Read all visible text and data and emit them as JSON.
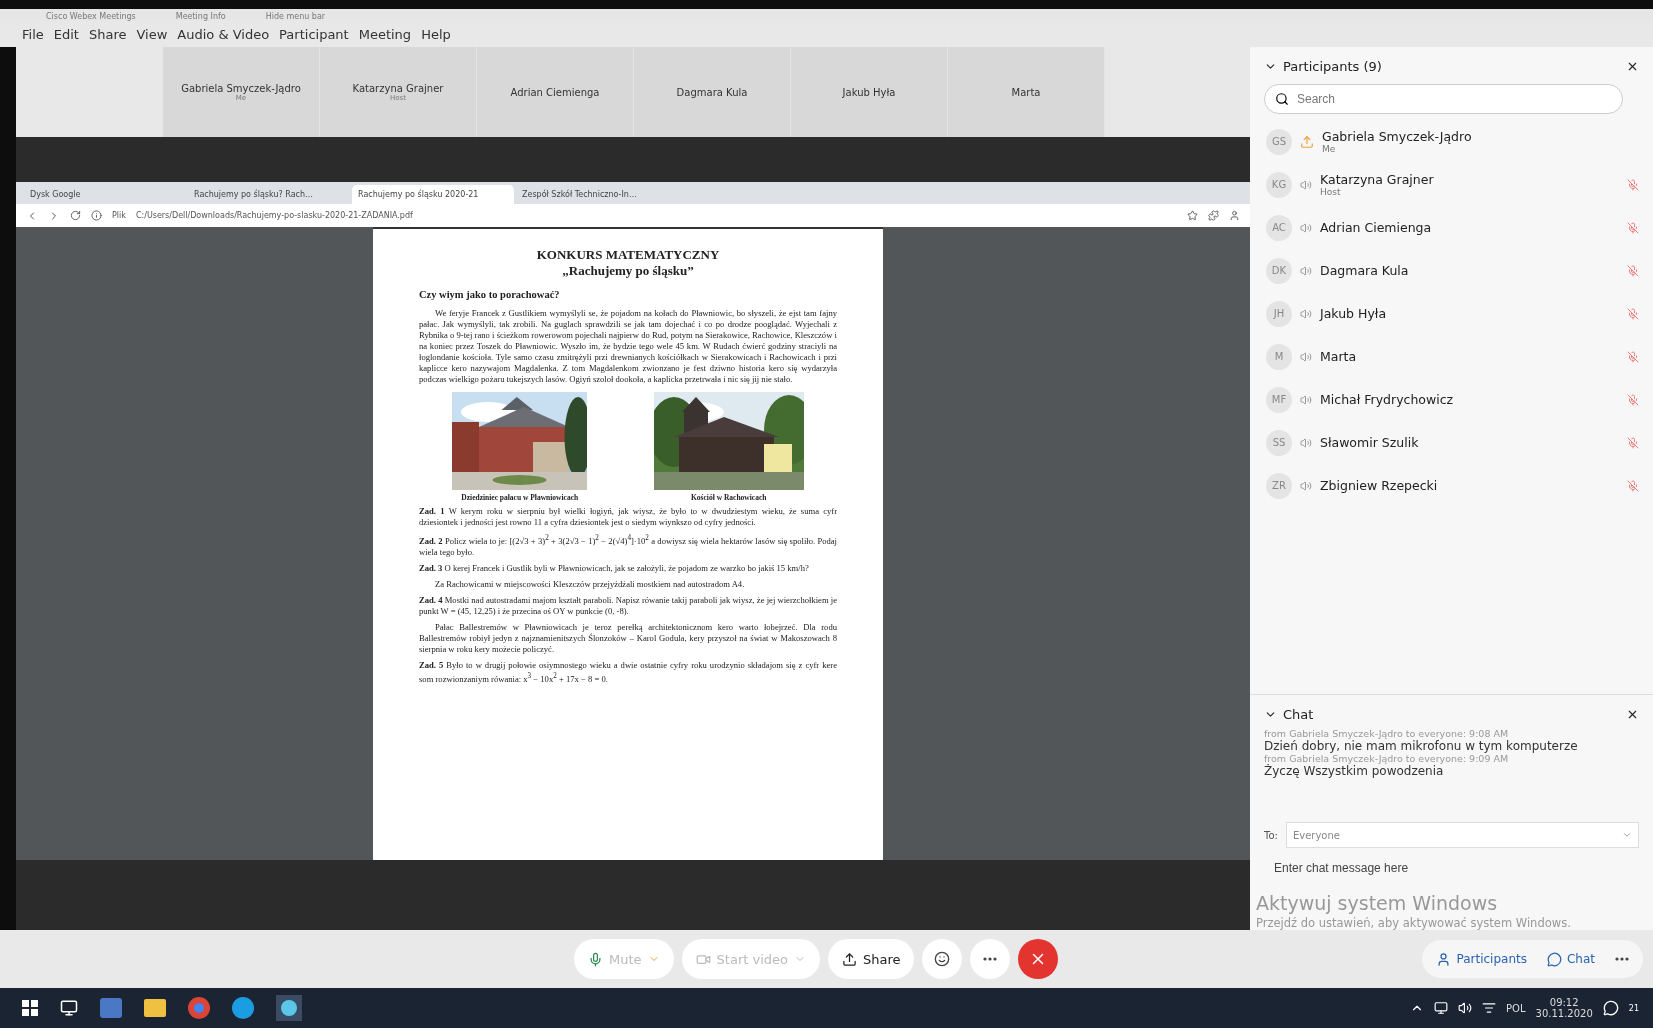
{
  "title_bar": {
    "items": [
      "Cisco Webex Meetings",
      "Meeting Info",
      "Hide menu bar"
    ]
  },
  "menu": [
    "File",
    "Edit",
    "Share",
    "View",
    "Audio & Video",
    "Participant",
    "Meeting",
    "Help"
  ],
  "video_strip": [
    {
      "name": "Gabriela Smyczek-Jądro",
      "role": "Me"
    },
    {
      "name": "Katarzyna Grajner",
      "role": "Host"
    },
    {
      "name": "Adrian Ciemienga"
    },
    {
      "name": "Dagmara Kula"
    },
    {
      "name": "Jakub Hyła"
    },
    {
      "name": "Marta"
    }
  ],
  "browser": {
    "tabs": [
      {
        "label": "Dysk Google",
        "selected": false
      },
      {
        "label": "Rachujemy po śląsku? Rach…",
        "selected": false
      },
      {
        "label": "Rachujemy po śląsku 2020-21",
        "selected": true
      },
      {
        "label": "Zespół Szkół Techniczno-In…",
        "selected": false
      }
    ],
    "url_scheme": "Plik",
    "url": "C:/Users/Dell/Downloads/Rachujemy-po-slasku-2020-21-ZADANIA.pdf"
  },
  "document": {
    "title": "KONKURS MATEMATYCZNY",
    "subtitle": "„Rachujemy po śląsku”",
    "heading": "Czy wiym jako to porachować?",
    "intro": "We feryje Francek z Gustlikiem wymyślyli se, że pojadom na kołach do Pławniowic, bo słyszeli, że ejst tam fajny pałac. Jak wymyślyli, tak zrobili. Na guglach sprawdzili se jak tam dojechać i co po drodze pooglądać. Wyjechali z Rybnika o 9-tej rano i ścieżkom rowerowom pojechali najpierw do Rud, potym na Sierakowice, Rachowice, Kleszczów i na koniec przez Toszek do Pławniowic. Wyszło im, że bydzie tego wele 45 km. W Rudach ćwierć godziny straciyli na łoglondanie kościoła. Tyle samo czasu zmitrężyli przi drewnianych kościółkach w Sierakowicach i Rachowicach i przi kaplicce kero nazywajom Magdalenka. Z tom Magdalenkom zwionzano je fest dziwno historia kero się wydarzyła podczas wielkigo pożaru tukejszych lasów. Ogiyń szoloł dookoła, a kaplicka przetrwała i nic się jij nie stało.",
    "figures": [
      {
        "caption": "Dziedziniec pałacu w Pławniowicach",
        "kind": "palace"
      },
      {
        "caption": "Kościół w Rachowicach",
        "kind": "church"
      }
    ],
    "body": [
      {
        "kind": "task",
        "label": "Zad. 1",
        "text": "W kerym roku w sierpniu był wielki łogiyń, jak wiysz, że było to w dwudziestym wieku, że suma cyfr dziesiontek i jedności jest rowno 11 a cyfra dziesiontek jest o siedym wiynkszo od cyfry jedności."
      },
      {
        "kind": "task",
        "label": "Zad. 2",
        "text": "Policz wiela to je: [(2√3 + 3)$^{2}$ + 3(2√3 − 1)$^{2}$ − 2(√4)$^{4}$]·10$^{2}$ a dowiysz się wiela hektarów lasów się spoliło. Podaj wiela tego było."
      },
      {
        "kind": "task",
        "label": "Zad. 3",
        "text": "O kerej Francek i Gustlik byli w Pławniowicach, jak se założyli, że pojadom ze warzko bo jakiś 15 km/h?"
      },
      {
        "kind": "para",
        "text": "Za Rachowicami w miejscowości Kleszczów przejyżdżali mostkiem nad autostradom A4."
      },
      {
        "kind": "task",
        "label": "Zad. 4",
        "text": "Mostki nad autostradami majom kształt paraboli. Napisz rówanie takij paraboli jak wiysz, że jej wierzchołkiem je punkt W = (45, 12,25) i że przecina oś OY w punkcie (0, -8)."
      },
      {
        "kind": "para",
        "text": "Pałac Ballestremów w Pławniowicach je teroz perełką architektonicznom kero warto łobejrzeć. Dla rodu Ballestremów robiył jedyn z najznamienitszych Ślonzoków – Karol Godula, kery przyszoł na świat w Makoszowach 8 sierpnia w roku kery możecie policzyć."
      },
      {
        "kind": "task",
        "label": "Zad. 5",
        "text": "Było to w drugij połowie osiymnostego wieku a dwie ostatnie cyfry roku urodzynio składajom się z cyfr kere som rozwionzaniym rówania:  x$^{3}$ − 10x$^{2}$ + 17x − 8 = 0."
      }
    ]
  },
  "participants": {
    "title": "Participants (9)",
    "search_placeholder": "Search",
    "items": [
      {
        "initials": "GS",
        "name": "Gabriela Smyczek-Jądro",
        "role": "Me",
        "presenter": true,
        "muted": false
      },
      {
        "initials": "KG",
        "name": "Katarzyna Grajner",
        "role": "Host",
        "presenter": false,
        "muted": true
      },
      {
        "initials": "AC",
        "name": "Adrian Ciemienga",
        "presenter": false,
        "muted": true
      },
      {
        "initials": "DK",
        "name": "Dagmara Kula",
        "presenter": false,
        "muted": true
      },
      {
        "initials": "JH",
        "name": "Jakub Hyła",
        "presenter": false,
        "muted": true
      },
      {
        "initials": "M",
        "name": "Marta",
        "presenter": false,
        "muted": true
      },
      {
        "initials": "MF",
        "name": "Michał Frydrychowicz",
        "presenter": false,
        "muted": true
      },
      {
        "initials": "SS",
        "name": "Sławomir Szulik",
        "presenter": false,
        "muted": true
      },
      {
        "initials": "ZR",
        "name": "Zbigniew Rzepecki",
        "presenter": false,
        "muted": true
      }
    ]
  },
  "chat": {
    "title": "Chat",
    "messages": [
      {
        "meta": "from Gabriela Smyczek-Jądro to everyone:   9:08 AM",
        "text": "Dzień dobry, nie mam mikrofonu w tym komputerze"
      },
      {
        "meta": "from Gabriela Smyczek-Jądro to everyone:   9:09 AM",
        "text": "Życzę Wszystkim powodzenia"
      }
    ],
    "to_label": "To:",
    "recipient": "Everyone",
    "placeholder": "Enter chat message here"
  },
  "activation": {
    "title": "Aktywuj system Windows",
    "text": "Przejdź do ustawień, aby aktywować system Windows."
  },
  "controls": [
    {
      "kind": "mute",
      "label": "Mute",
      "disabled": true
    },
    {
      "kind": "video",
      "label": "Start video",
      "disabled": true
    },
    {
      "kind": "share",
      "label": "Share",
      "disabled": false
    },
    {
      "kind": "reactions",
      "disabled": false
    },
    {
      "kind": "more",
      "disabled": false
    },
    {
      "kind": "end",
      "disabled": false
    }
  ],
  "side_controls": [
    {
      "kind": "participants",
      "label": "Participants"
    },
    {
      "kind": "chat",
      "label": "Chat"
    },
    {
      "kind": "more"
    }
  ],
  "taskbar": {
    "language": "POL",
    "time": "09:12",
    "date": "30.11.2020",
    "notifications": "21"
  }
}
